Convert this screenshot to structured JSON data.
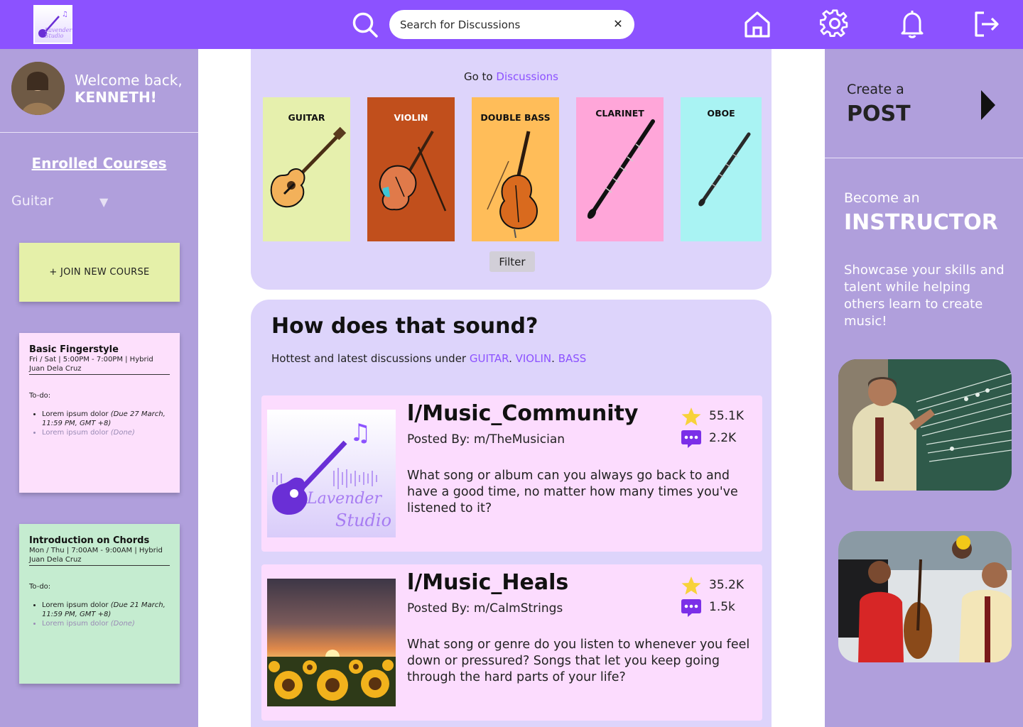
{
  "topbar": {
    "logo_text": "Lavender Studio",
    "search_placeholder": "Search for Discussions",
    "search_clear": "✕",
    "icons": [
      "search-icon",
      "home-icon",
      "gear-icon",
      "bell-icon",
      "logout-icon"
    ],
    "color": "#8c52ff"
  },
  "profile": {
    "welcome": "Welcome back,",
    "name": "KENNETH!"
  },
  "courses": {
    "title": "Enrolled Courses",
    "selected": "Guitar",
    "join_label": "+ JOIN NEW COURSE",
    "cards": [
      {
        "title": "Basic Fingerstyle",
        "schedule": "Fri / Sat | 5:00PM - 7:00PM | Hybrid",
        "instructor": "Juan Dela Cruz",
        "todo_label": "To-do:",
        "item1": "Lorem ipsum dolor",
        "item1_due": "(Due 27 March, 11:59 PM, GMT +8)",
        "item2": "Lorem ipsum dolor",
        "item2_status": "(Done)",
        "color": "#fde0fc"
      },
      {
        "title": "Introduction on Chords",
        "schedule": "Mon / Thu | 7:00AM - 9:00AM | Hybrid",
        "instructor": "Juan Dela Cruz",
        "todo_label": "To-do:",
        "item1": "Lorem ipsum dolor",
        "item1_due": "(Due 21 March, 11:59 PM, GMT +8)",
        "item2": "Lorem ipsum dolor",
        "item2_status": "(Done)",
        "color": "#c5ecd0"
      }
    ]
  },
  "discussions_nav": {
    "goto": "Go to",
    "goto_link": "Discussions",
    "instruments": [
      {
        "name": "GUITAR",
        "color": "#e6f0ad"
      },
      {
        "name": "VIOLIN",
        "color": "#c14f1c"
      },
      {
        "name": "DOUBLE BASS",
        "color": "#ffbd59"
      },
      {
        "name": "CLARINET",
        "color": "#ffa6d9"
      },
      {
        "name": "OBOE",
        "color": "#a9f3f3"
      }
    ],
    "filter_label": "Filter"
  },
  "feed": {
    "title": "How does that sound?",
    "sub_prefix": "Hottest and latest discussions under",
    "tag1": "GUITAR",
    "tag2": "VIOLIN",
    "tag3": "BASS",
    "sep": ".",
    "posts": [
      {
        "community": "l/Music_Community",
        "posted_by": "Posted By: m/TheMusician",
        "body": "What song or album can you always go back to and have a good time, no matter how many times you've listened to it?",
        "stars": "55.1K",
        "comments": "2.2K",
        "image_text": "Lavender Studio"
      },
      {
        "community": "l/Music_Heals",
        "posted_by": "Posted By: m/CalmStrings",
        "body": "What song or genre do you listen to whenever you feel down or pressured? Songs that let you keep going through the hard parts of your life?",
        "stars": "35.2K",
        "comments": "1.5k"
      }
    ]
  },
  "right": {
    "create_small": "Create a",
    "create_big": "POST",
    "instr_small": "Become an",
    "instr_big": "INSTRUCTOR",
    "instr_desc": "Showcase your skills and talent while helping others learn to create music!"
  }
}
